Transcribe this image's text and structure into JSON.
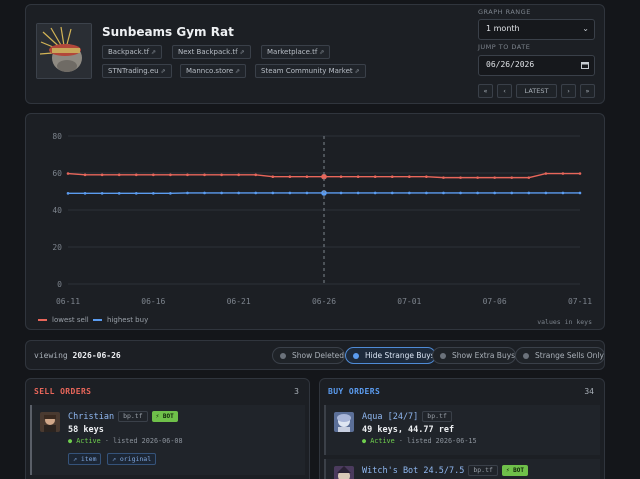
{
  "header": {
    "title": "Sunbeams Gym Rat",
    "links": [
      {
        "label": "Backpack.tf",
        "icon": "external-link-icon"
      },
      {
        "label": "Next Backpack.tf",
        "icon": "external-link-icon"
      },
      {
        "label": "Marketplace.tf",
        "icon": "external-link-icon"
      },
      {
        "label": "STNTrading.eu",
        "icon": "external-link-icon"
      },
      {
        "label": "Mannco.store",
        "icon": "external-link-icon"
      },
      {
        "label": "Steam Community Market",
        "icon": "external-link-icon"
      }
    ],
    "ext_glyph": "⇗"
  },
  "controls": {
    "graph_range_label": "GRAPH RANGE",
    "graph_range_value": "1 month",
    "jump_label": "JUMP TO DATE",
    "jump_value": "06/26/2026",
    "nav": {
      "first": "«",
      "prev": "‹",
      "latest": "LATEST",
      "next": "›",
      "last": "»"
    }
  },
  "chart_data": {
    "type": "line",
    "x": [
      "06-11",
      "06-12",
      "06-13",
      "06-14",
      "06-15",
      "06-16",
      "06-17",
      "06-18",
      "06-19",
      "06-20",
      "06-21",
      "06-22",
      "06-23",
      "06-24",
      "06-25",
      "06-26",
      "06-27",
      "06-28",
      "06-29",
      "06-30",
      "07-01",
      "07-02",
      "07-03",
      "07-04",
      "07-05",
      "07-06",
      "07-07",
      "07-08",
      "07-09",
      "07-10",
      "07-11"
    ],
    "x_ticks": [
      "06-11",
      "06-16",
      "06-21",
      "06-26",
      "07-01",
      "07-06",
      "07-11"
    ],
    "y_ticks": [
      0,
      20,
      40,
      60,
      80
    ],
    "ylim": [
      0,
      80
    ],
    "grid": true,
    "cursor_x": "06-26",
    "series": [
      {
        "name": "lowest sell",
        "color": "#e8665a",
        "values": [
          59.7,
          59.0,
          59.0,
          59.0,
          59.0,
          59.0,
          59.0,
          59.0,
          59.0,
          59.0,
          59.0,
          59.0,
          58.0,
          58.0,
          58.0,
          58.0,
          58.0,
          58.0,
          58.0,
          58.0,
          58.0,
          58.0,
          57.5,
          57.5,
          57.5,
          57.5,
          57.5,
          57.5,
          59.7,
          59.7,
          59.7
        ]
      },
      {
        "name": "highest buy",
        "color": "#5b9cf0",
        "values": [
          49.0,
          49.0,
          49.0,
          49.0,
          49.0,
          49.0,
          49.0,
          49.2,
          49.2,
          49.2,
          49.2,
          49.2,
          49.2,
          49.2,
          49.2,
          49.2,
          49.2,
          49.2,
          49.2,
          49.2,
          49.2,
          49.2,
          49.2,
          49.2,
          49.2,
          49.2,
          49.2,
          49.2,
          49.2,
          49.2,
          49.2
        ]
      }
    ],
    "units_note": "values in keys"
  },
  "filters": {
    "viewing_prefix": "viewing",
    "viewing_date": "2026-06-26",
    "toggles": [
      {
        "label": "Show Deleted",
        "on": false
      },
      {
        "label": "Hide Strange Buys",
        "on": true
      },
      {
        "label": "Show Extra Buys",
        "on": false
      },
      {
        "label": "Strange Sells Only",
        "on": false
      }
    ]
  },
  "sell_orders": {
    "heading": "SELL ORDERS",
    "count": "3",
    "color": "#e8665a",
    "items": [
      {
        "name": "Christian",
        "tag": "bp.tf",
        "bot": "⚡ BOT",
        "price": "58 keys",
        "status": "Active",
        "listed": "· listed 2026-06-08",
        "links": [
          "⇗ item",
          "⇗ original"
        ]
      }
    ]
  },
  "buy_orders": {
    "heading": "BUY ORDERS",
    "count": "34",
    "color": "#5b9cf0",
    "items": [
      {
        "name": "Aqua [24/7]",
        "tag": "bp.tf",
        "price": "49 keys, 44.77 ref",
        "status": "Active",
        "listed": "· listed 2026-06-15"
      },
      {
        "name": "Witch's Bot 24.5/7.5",
        "tag": "bp.tf",
        "bot": "⚡ BOT"
      }
    ]
  }
}
